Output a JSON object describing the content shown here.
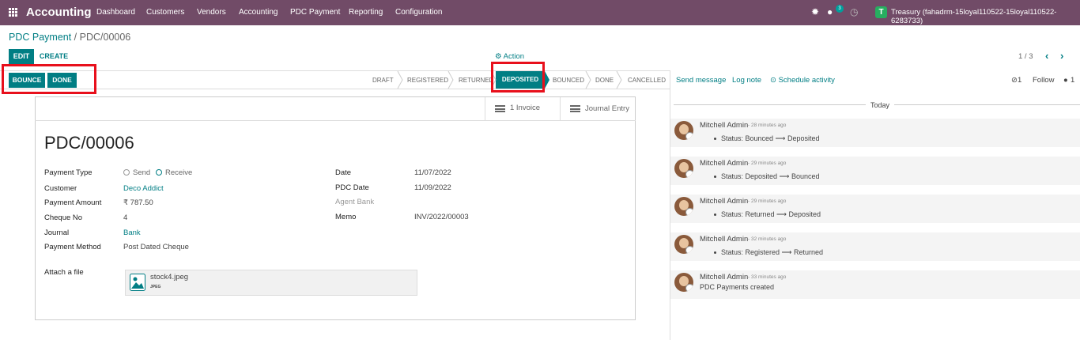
{
  "nav": {
    "app": "Accounting",
    "menu": [
      "Dashboard",
      "Customers",
      "Vendors",
      "Accounting",
      "PDC Payment",
      "Reporting",
      "Configuration"
    ],
    "chat_count": "3",
    "user_initial": "T",
    "user": "Treasury (fahadrm-15loyal110522-15loyal110522-6283733)",
    "icons": [
      "apps-grid-icon",
      "bug-icon",
      "chat-icon",
      "clock-icon"
    ]
  },
  "breadcrumb": {
    "parent": "PDC Payment",
    "sep": " / ",
    "current": "PDC/00006"
  },
  "toolbar": {
    "edit": "EDIT",
    "create": "CREATE",
    "action": "⚙ Action",
    "pager": "1 / 3",
    "prev": "‹",
    "next": "›"
  },
  "status": {
    "bounce": "BOUNCE",
    "done": "DONE",
    "stages": [
      "DRAFT",
      "REGISTERED",
      "RETURNED",
      "DEPOSITED",
      "BOUNCED",
      "DONE",
      "CANCELLED"
    ],
    "active": "DEPOSITED"
  },
  "smart": {
    "invoice": "1 Invoice",
    "journal": "Journal Entry"
  },
  "form": {
    "title": "PDC/00006",
    "left": [
      {
        "label": "Payment Type",
        "value": ""
      },
      {
        "label": "Customer",
        "value": "Deco Addict"
      },
      {
        "label": "Payment Amount",
        "value": "₹ 787.50"
      },
      {
        "label": "Cheque No",
        "value": "4"
      },
      {
        "label": "Journal",
        "value": "Bank"
      },
      {
        "label": "Payment Method",
        "value": "Post Dated Cheque"
      }
    ],
    "payment_type_options": [
      "Send",
      "Receive"
    ],
    "payment_type_selected": "Receive",
    "right": [
      {
        "label": "Date",
        "value": "11/07/2022"
      },
      {
        "label": "PDC Date",
        "value": "11/09/2022"
      },
      {
        "label": "Agent Bank",
        "value": ""
      },
      {
        "label": "Memo",
        "value": "INV/2022/00003"
      }
    ],
    "attach_label": "Attach a file",
    "attachment": {
      "name": "stock4.jpeg",
      "ext": "JPEG"
    }
  },
  "chatter": {
    "send": "Send message",
    "log": "Log note",
    "schedule": "⊙ Schedule activity",
    "attachments": "⊘1",
    "follow": "Follow",
    "followers": "1",
    "today": "Today",
    "messages": [
      {
        "author": "Mitchell Admin",
        "time": "- 28 minutes ago",
        "body": "Status: Bounced ⟶ Deposited",
        "bullet": true
      },
      {
        "author": "Mitchell Admin",
        "time": "- 29 minutes ago",
        "body": "Status: Deposited ⟶ Bounced",
        "bullet": true
      },
      {
        "author": "Mitchell Admin",
        "time": "- 29 minutes ago",
        "body": "Status: Returned ⟶ Deposited",
        "bullet": true
      },
      {
        "author": "Mitchell Admin",
        "time": "- 32 minutes ago",
        "body": "Status: Registered ⟶ Returned",
        "bullet": true
      },
      {
        "author": "Mitchell Admin",
        "time": "- 33 minutes ago",
        "body": "PDC Payments created",
        "bullet": false
      }
    ]
  },
  "colors": {
    "nav": "#714b67",
    "accent": "#017e84",
    "highlight": "#e8101c"
  }
}
